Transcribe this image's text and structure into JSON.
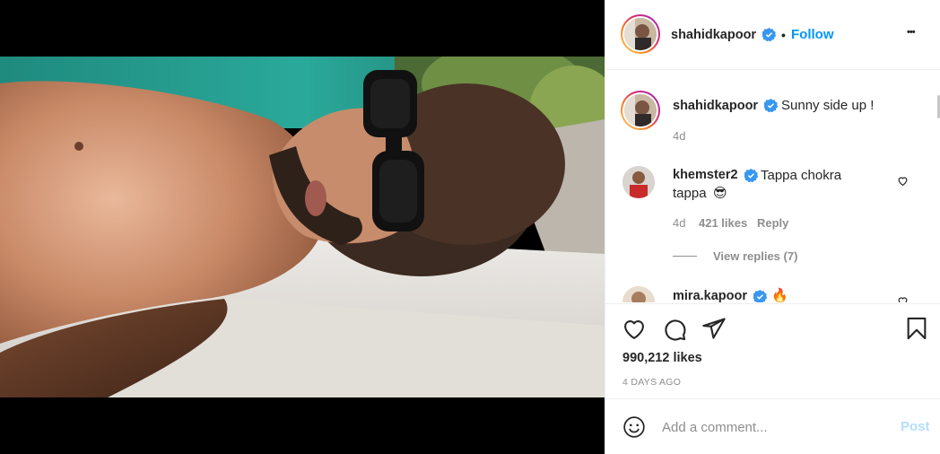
{
  "post": {
    "author": "shahidkapoor",
    "follow_label": "Follow",
    "separator": "•",
    "more_label": "•••",
    "caption": "Sunny side up !",
    "caption_age": "4d"
  },
  "comments": [
    {
      "user": "khemster2",
      "text_line1": "Tappa chokra",
      "text_line2": "tappa",
      "emoji": "😎",
      "age": "4d",
      "likes": "421 likes",
      "reply_label": "Reply",
      "view_replies": "View replies (7)"
    },
    {
      "user": "mira.kapoor",
      "emoji": "🔥"
    }
  ],
  "actions": {
    "likes": "990,212 likes",
    "time_ago": "4 DAYS AGO"
  },
  "add_comment": {
    "placeholder": "Add a comment...",
    "post_label": "Post"
  },
  "icons": {
    "like": "heart-icon",
    "comment": "comment-icon",
    "share": "share-icon",
    "save": "bookmark-icon",
    "emoji": "emoji-icon",
    "verified": "verified-badge-icon",
    "more": "more-options-icon"
  },
  "colors": {
    "link_blue": "#0095f6",
    "muted_text": "#8e8e8e",
    "post_disabled": "#b2dffc",
    "verified_blue": "#3897f0"
  }
}
